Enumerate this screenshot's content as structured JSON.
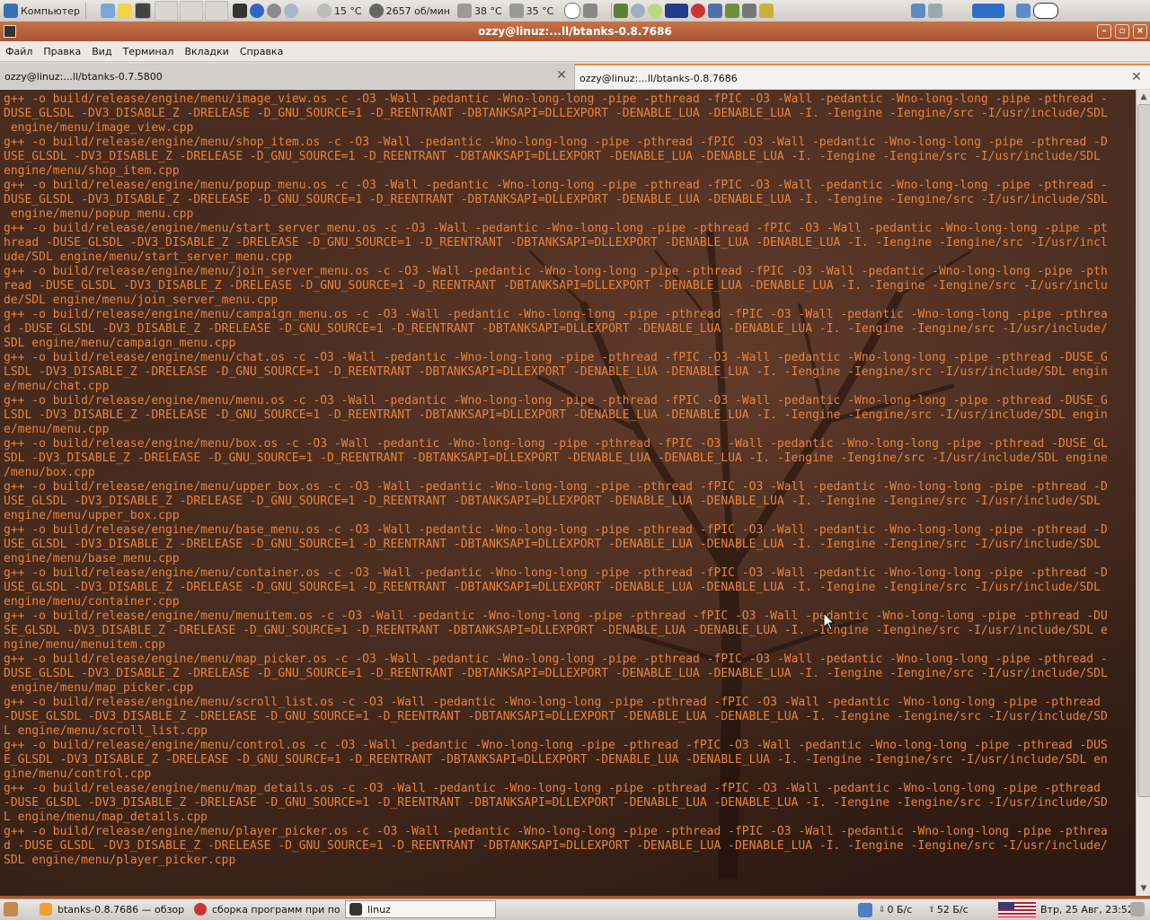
{
  "top_panel": {
    "places_label": "Компьютер",
    "temperature": "15 °C",
    "fan_speed": "2657 об/мин",
    "temp_cpu": "38 °C",
    "temp_hdd": "35 °C"
  },
  "window": {
    "title": "ozzy@linuz:...ll/btanks-0.8.7686"
  },
  "menubar": [
    "Файл",
    "Правка",
    "Вид",
    "Терминал",
    "Вкладки",
    "Справка"
  ],
  "tabs": [
    {
      "label": "ozzy@linuz:...ll/btanks-0.7.5800"
    },
    {
      "label": "ozzy@linuz:...ll/btanks-0.8.7686"
    }
  ],
  "terminal": {
    "lines": [
      "g++ -o build/release/engine/menu/image_view.os -c -O3 -Wall -pedantic -Wno-long-long -pipe -pthread -fPIC -O3 -Wall -pedantic -Wno-long-long -pipe -pthread -",
      "DUSE_GLSDL -DV3_DISABLE_Z -DRELEASE -D_GNU_SOURCE=1 -D_REENTRANT -DBTANKSAPI=DLLEXPORT -DENABLE_LUA -DENABLE_LUA -I. -Iengine -Iengine/src -I/usr/include/SDL",
      " engine/menu/image_view.cpp",
      "g++ -o build/release/engine/menu/shop_item.os -c -O3 -Wall -pedantic -Wno-long-long -pipe -pthread -fPIC -O3 -Wall -pedantic -Wno-long-long -pipe -pthread -D",
      "USE_GLSDL -DV3_DISABLE_Z -DRELEASE -D_GNU_SOURCE=1 -D_REENTRANT -DBTANKSAPI=DLLEXPORT -DENABLE_LUA -DENABLE_LUA -I. -Iengine -Iengine/src -I/usr/include/SDL",
      "engine/menu/shop_item.cpp",
      "g++ -o build/release/engine/menu/popup_menu.os -c -O3 -Wall -pedantic -Wno-long-long -pipe -pthread -fPIC -O3 -Wall -pedantic -Wno-long-long -pipe -pthread -",
      "DUSE_GLSDL -DV3_DISABLE_Z -DRELEASE -D_GNU_SOURCE=1 -D_REENTRANT -DBTANKSAPI=DLLEXPORT -DENABLE_LUA -DENABLE_LUA -I. -Iengine -Iengine/src -I/usr/include/SDL",
      " engine/menu/popup_menu.cpp",
      "g++ -o build/release/engine/menu/start_server_menu.os -c -O3 -Wall -pedantic -Wno-long-long -pipe -pthread -fPIC -O3 -Wall -pedantic -Wno-long-long -pipe -pt",
      "hread -DUSE_GLSDL -DV3_DISABLE_Z -DRELEASE -D_GNU_SOURCE=1 -D_REENTRANT -DBTANKSAPI=DLLEXPORT -DENABLE_LUA -DENABLE_LUA -I. -Iengine -Iengine/src -I/usr/incl",
      "ude/SDL engine/menu/start_server_menu.cpp",
      "g++ -o build/release/engine/menu/join_server_menu.os -c -O3 -Wall -pedantic -Wno-long-long -pipe -pthread -fPIC -O3 -Wall -pedantic -Wno-long-long -pipe -pth",
      "read -DUSE_GLSDL -DV3_DISABLE_Z -DRELEASE -D_GNU_SOURCE=1 -D_REENTRANT -DBTANKSAPI=DLLEXPORT -DENABLE_LUA -DENABLE_LUA -I. -Iengine -Iengine/src -I/usr/inclu",
      "de/SDL engine/menu/join_server_menu.cpp",
      "g++ -o build/release/engine/menu/campaign_menu.os -c -O3 -Wall -pedantic -Wno-long-long -pipe -pthread -fPIC -O3 -Wall -pedantic -Wno-long-long -pipe -pthrea",
      "d -DUSE_GLSDL -DV3_DISABLE_Z -DRELEASE -D_GNU_SOURCE=1 -D_REENTRANT -DBTANKSAPI=DLLEXPORT -DENABLE_LUA -DENABLE_LUA -I. -Iengine -Iengine/src -I/usr/include/",
      "SDL engine/menu/campaign_menu.cpp",
      "g++ -o build/release/engine/menu/chat.os -c -O3 -Wall -pedantic -Wno-long-long -pipe -pthread -fPIC -O3 -Wall -pedantic -Wno-long-long -pipe -pthread -DUSE_G",
      "LSDL -DV3_DISABLE_Z -DRELEASE -D_GNU_SOURCE=1 -D_REENTRANT -DBTANKSAPI=DLLEXPORT -DENABLE_LUA -DENABLE_LUA -I. -Iengine -Iengine/src -I/usr/include/SDL engin",
      "e/menu/chat.cpp",
      "g++ -o build/release/engine/menu/menu.os -c -O3 -Wall -pedantic -Wno-long-long -pipe -pthread -fPIC -O3 -Wall -pedantic -Wno-long-long -pipe -pthread -DUSE_G",
      "LSDL -DV3_DISABLE_Z -DRELEASE -D_GNU_SOURCE=1 -D_REENTRANT -DBTANKSAPI=DLLEXPORT -DENABLE_LUA -DENABLE_LUA -I. -Iengine -Iengine/src -I/usr/include/SDL engin",
      "e/menu/menu.cpp",
      "g++ -o build/release/engine/menu/box.os -c -O3 -Wall -pedantic -Wno-long-long -pipe -pthread -fPIC -O3 -Wall -pedantic -Wno-long-long -pipe -pthread -DUSE_GL",
      "SDL -DV3_DISABLE_Z -DRELEASE -D_GNU_SOURCE=1 -D_REENTRANT -DBTANKSAPI=DLLEXPORT -DENABLE_LUA -DENABLE_LUA -I. -Iengine -Iengine/src -I/usr/include/SDL engine",
      "/menu/box.cpp",
      "g++ -o build/release/engine/menu/upper_box.os -c -O3 -Wall -pedantic -Wno-long-long -pipe -pthread -fPIC -O3 -Wall -pedantic -Wno-long-long -pipe -pthread -D",
      "USE_GLSDL -DV3_DISABLE_Z -DRELEASE -D_GNU_SOURCE=1 -D_REENTRANT -DBTANKSAPI=DLLEXPORT -DENABLE_LUA -DENABLE_LUA -I. -Iengine -Iengine/src -I/usr/include/SDL",
      "engine/menu/upper_box.cpp",
      "g++ -o build/release/engine/menu/base_menu.os -c -O3 -Wall -pedantic -Wno-long-long -pipe -pthread -fPIC -O3 -Wall -pedantic -Wno-long-long -pipe -pthread -D",
      "USE_GLSDL -DV3_DISABLE_Z -DRELEASE -D_GNU_SOURCE=1 -D_REENTRANT -DBTANKSAPI=DLLEXPORT -DENABLE_LUA -DENABLE_LUA -I. -Iengine -Iengine/src -I/usr/include/SDL",
      "engine/menu/base_menu.cpp",
      "g++ -o build/release/engine/menu/container.os -c -O3 -Wall -pedantic -Wno-long-long -pipe -pthread -fPIC -O3 -Wall -pedantic -Wno-long-long -pipe -pthread -D",
      "USE_GLSDL -DV3_DISABLE_Z -DRELEASE -D_GNU_SOURCE=1 -D_REENTRANT -DBTANKSAPI=DLLEXPORT -DENABLE_LUA -DENABLE_LUA -I. -Iengine -Iengine/src -I/usr/include/SDL",
      "engine/menu/container.cpp",
      "g++ -o build/release/engine/menu/menuitem.os -c -O3 -Wall -pedantic -Wno-long-long -pipe -pthread -fPIC -O3 -Wall -pedantic -Wno-long-long -pipe -pthread -DU",
      "SE_GLSDL -DV3_DISABLE_Z -DRELEASE -D_GNU_SOURCE=1 -D_REENTRANT -DBTANKSAPI=DLLEXPORT -DENABLE_LUA -DENABLE_LUA -I. -Iengine -Iengine/src -I/usr/include/SDL e",
      "ngine/menu/menuitem.cpp",
      "g++ -o build/release/engine/menu/map_picker.os -c -O3 -Wall -pedantic -Wno-long-long -pipe -pthread -fPIC -O3 -Wall -pedantic -Wno-long-long -pipe -pthread -",
      "DUSE_GLSDL -DV3_DISABLE_Z -DRELEASE -D_GNU_SOURCE=1 -D_REENTRANT -DBTANKSAPI=DLLEXPORT -DENABLE_LUA -DENABLE_LUA -I. -Iengine -Iengine/src -I/usr/include/SDL",
      " engine/menu/map_picker.cpp",
      "g++ -o build/release/engine/menu/scroll_list.os -c -O3 -Wall -pedantic -Wno-long-long -pipe -pthread -fPIC -O3 -Wall -pedantic -Wno-long-long -pipe -pthread",
      "-DUSE_GLSDL -DV3_DISABLE_Z -DRELEASE -D_GNU_SOURCE=1 -D_REENTRANT -DBTANKSAPI=DLLEXPORT -DENABLE_LUA -DENABLE_LUA -I. -Iengine -Iengine/src -I/usr/include/SD",
      "L engine/menu/scroll_list.cpp",
      "g++ -o build/release/engine/menu/control.os -c -O3 -Wall -pedantic -Wno-long-long -pipe -pthread -fPIC -O3 -Wall -pedantic -Wno-long-long -pipe -pthread -DUS",
      "E_GLSDL -DV3_DISABLE_Z -DRELEASE -D_GNU_SOURCE=1 -D_REENTRANT -DBTANKSAPI=DLLEXPORT -DENABLE_LUA -DENABLE_LUA -I. -Iengine -Iengine/src -I/usr/include/SDL en",
      "gine/menu/control.cpp",
      "g++ -o build/release/engine/menu/map_details.os -c -O3 -Wall -pedantic -Wno-long-long -pipe -pthread -fPIC -O3 -Wall -pedantic -Wno-long-long -pipe -pthread",
      "-DUSE_GLSDL -DV3_DISABLE_Z -DRELEASE -D_GNU_SOURCE=1 -D_REENTRANT -DBTANKSAPI=DLLEXPORT -DENABLE_LUA -DENABLE_LUA -I. -Iengine -Iengine/src -I/usr/include/SD",
      "L engine/menu/map_details.cpp",
      "g++ -o build/release/engine/menu/player_picker.os -c -O3 -Wall -pedantic -Wno-long-long -pipe -pthread -fPIC -O3 -Wall -pedantic -Wno-long-long -pipe -pthrea",
      "d -DUSE_GLSDL -DV3_DISABLE_Z -DRELEASE -D_GNU_SOURCE=1 -D_REENTRANT -DBTANKSAPI=DLLEXPORT -DENABLE_LUA -DENABLE_LUA -I. -Iengine -Iengine/src -I/usr/include/",
      "SDL engine/menu/player_picker.cpp"
    ]
  },
  "taskbar": {
    "tasks": [
      {
        "label": "btanks-0.8.7686 — обзор"
      },
      {
        "label": "сборка программ при по..."
      },
      {
        "label": "linuz"
      }
    ],
    "net_down": "0 Б/с",
    "net_up": "52 Б/с",
    "clock": "Втр, 25 Авг, 23:52"
  },
  "colors": {
    "terminal_text": "#e8843a",
    "titlebar": "#b5603a",
    "active_tab_accent": "#e08a4f"
  }
}
